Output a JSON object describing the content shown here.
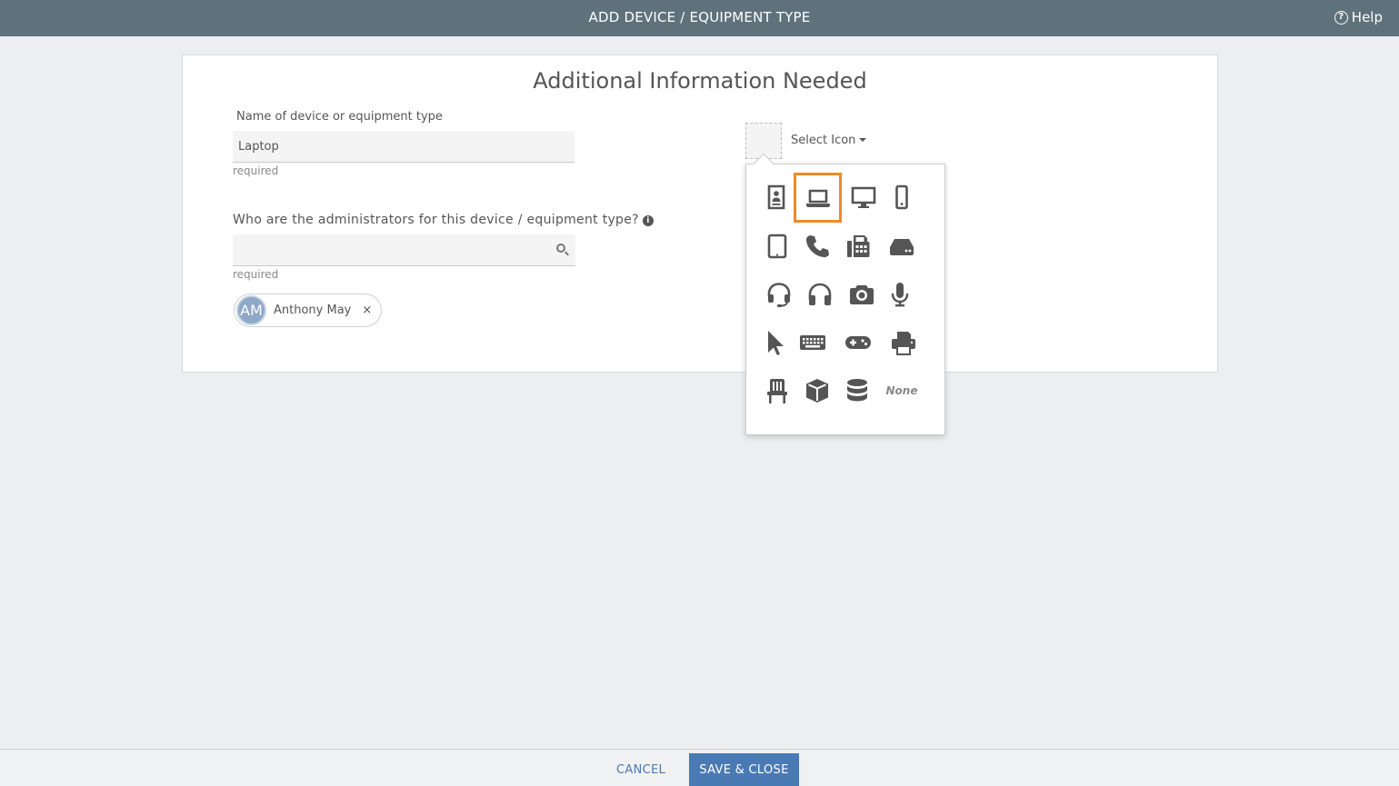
{
  "header": {
    "title": "ADD DEVICE / EQUIPMENT TYPE",
    "help_label": "Help",
    "help_icon": "question-circle-icon"
  },
  "form": {
    "heading": "Additional Information Needed",
    "name_label": "Name of device or equipment type",
    "name_value": "Laptop",
    "name_hint": "required",
    "admins_label": "Who are the administrators for this device / equipment type?",
    "admins_value": "",
    "admins_hint": "required",
    "admin_chip": {
      "initials": "AM",
      "name": "Anthony May",
      "remove": "×"
    }
  },
  "icon_picker": {
    "select_label": "Select Icon",
    "selected": "laptop-icon",
    "icons": [
      "id-badge-icon",
      "laptop-icon",
      "desktop-icon",
      "mobile-icon",
      "tablet-icon",
      "phone-icon",
      "fax-icon",
      "hard-drive-icon",
      "headset-icon",
      "headphones-icon",
      "camera-icon",
      "microphone-icon",
      "mouse-pointer-icon",
      "keyboard-icon",
      "gamepad-icon",
      "printer-icon",
      "chair-icon",
      "cube-icon",
      "database-icon",
      "none"
    ],
    "none_label": "None",
    "highlight_color": "#f08a24"
  },
  "footer": {
    "cancel_label": "CANCEL",
    "save_label": "SAVE & CLOSE"
  },
  "colors": {
    "topbar": "#5f727c",
    "primary": "#4a7ab3"
  }
}
